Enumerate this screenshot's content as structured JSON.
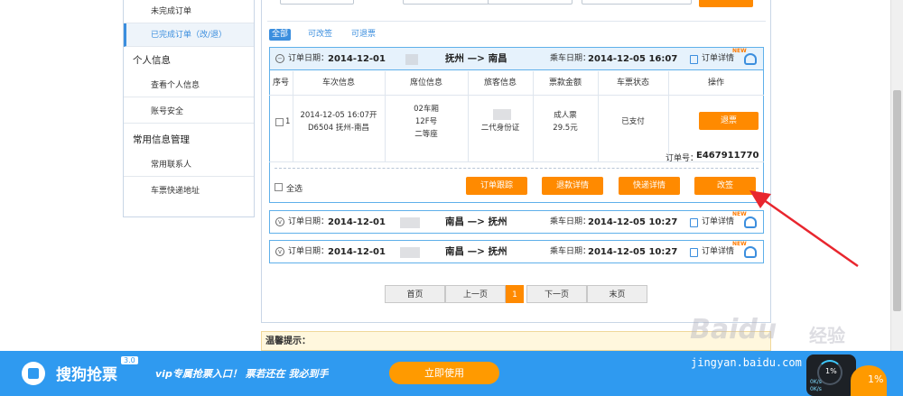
{
  "sidebar": {
    "items": [
      {
        "label": "未完成订单"
      },
      {
        "label": "已完成订单（改/退）"
      },
      {
        "label": "个人信息"
      },
      {
        "label": "查看个人信息"
      },
      {
        "label": "账号安全"
      },
      {
        "label": "常用信息管理"
      },
      {
        "label": "常用联系人"
      },
      {
        "label": "车票快递地址"
      }
    ]
  },
  "filters": [
    "全部",
    "可改签",
    "可退票"
  ],
  "table": {
    "headers": [
      "序号",
      "车次信息",
      "席位信息",
      "旅客信息",
      "票款金额",
      "车票状态",
      "操作"
    ]
  },
  "orders": [
    {
      "order_date_label": "订单日期：",
      "order_date": "2014-12-01",
      "route": "抚州 —> 南昌",
      "ride_date_label": "乘车日期：",
      "ride_date": "2014-12-05 16:07",
      "detail_label": "订单详情",
      "new_badge": "NEW",
      "row": {
        "index": "1",
        "train_line1": "2014-12-05 16:07开",
        "train_line2": "D6504 抚州-南昌",
        "seat_line1": "02车厢",
        "seat_line2": "12F号",
        "seat_line3": "二等座",
        "passenger_id": "二代身份证",
        "price_line1": "成人票",
        "price_line2": "29.5元",
        "status": "已支付",
        "action": "退票"
      },
      "order_no_label": "订单号：",
      "order_no": "E467911770",
      "select_all": "全选",
      "actions": [
        "订单跟踪",
        "退款详情",
        "快递详情",
        "改签"
      ]
    },
    {
      "order_date_label": "订单日期：",
      "order_date": "2014-12-01",
      "route": "南昌 —> 抚州",
      "ride_date_label": "乘车日期：",
      "ride_date": "2014-12-05 10:27",
      "detail_label": "订单详情",
      "new_badge": "NEW"
    },
    {
      "order_date_label": "订单日期：",
      "order_date": "2014-12-01",
      "route": "南昌 —> 抚州",
      "ride_date_label": "乘车日期：",
      "ride_date": "2014-12-05 10:27",
      "detail_label": "订单详情",
      "new_badge": "NEW"
    }
  ],
  "pagination": {
    "first": "首页",
    "prev": "上一页",
    "current": "1",
    "next": "下一页",
    "last": "末页"
  },
  "tips": {
    "title": "温馨提示："
  },
  "banner": {
    "title": "搜狗抢票",
    "version": "3.0",
    "slogan": "vip专属抢票入口！ 票若还在 我必到手",
    "button": "立即使用"
  },
  "watermark": {
    "logo": "Baidu",
    "cn": "经验",
    "url": "jingyan.baidu.com"
  },
  "netmon": {
    "percent": "1%",
    "up": "0K/s",
    "down": "0K/s"
  },
  "ball": {
    "percent": "1%"
  },
  "colors": {
    "accent": "#ff8a00",
    "primary_blue": "#3b8ede",
    "banner_blue": "#2f9af0",
    "arrow_red": "#e8262e"
  }
}
